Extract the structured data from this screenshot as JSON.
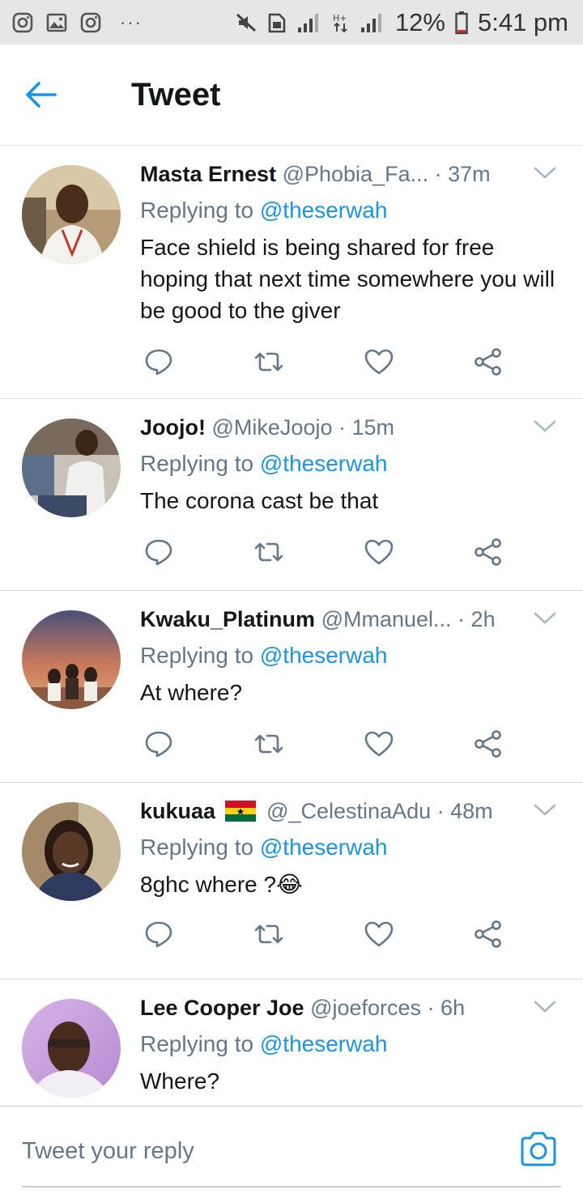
{
  "status_bar": {
    "left_icons": [
      "instagram-icon",
      "gallery-icon",
      "instagram-icon"
    ],
    "dots": "···",
    "right_icons": [
      "mute-icon",
      "sim-icon",
      "signal-icon",
      "data-icon",
      "signal-icon",
      "battery-icon"
    ],
    "battery": "12%",
    "time": "5:41 pm"
  },
  "header": {
    "title": "Tweet",
    "back_icon": "arrow-left-icon"
  },
  "tweets": [
    {
      "name": "Masta Ernest",
      "handle": "@Phobia_Fa...",
      "time": "· 37m",
      "replying_prefix": "Replying to ",
      "replying_to": "@theserwah",
      "text": "Face shield is being shared for free hoping that next time somewhere you will be good to the giver"
    },
    {
      "name": "Joojo!",
      "handle": "@MikeJoojo",
      "time": "· 15m",
      "replying_prefix": "Replying to ",
      "replying_to": "@theserwah",
      "text": "The corona cast be that"
    },
    {
      "name": "Kwaku_Platinum",
      "handle": "@Mmanuel...",
      "time": "· 2h",
      "replying_prefix": "Replying to ",
      "replying_to": "@theserwah",
      "text": "At where?"
    },
    {
      "name": "kukuaa",
      "handle": "@_CelestinaAdu",
      "time": "· 48m",
      "replying_prefix": "Replying to ",
      "replying_to": "@theserwah",
      "text": "8ghc where ?😂"
    },
    {
      "name": "Lee Cooper Joe",
      "handle": "@joeforces",
      "time": "· 6h",
      "replying_prefix": "Replying to ",
      "replying_to": "@theserwah",
      "text": "Where?"
    }
  ],
  "reply_bar": {
    "placeholder": "Tweet your reply",
    "camera_icon": "camera-icon"
  },
  "colors": {
    "accent": "#1b95e0",
    "secondary_text": "#657786",
    "primary_text": "#14171a",
    "divider": "#dadde1"
  }
}
